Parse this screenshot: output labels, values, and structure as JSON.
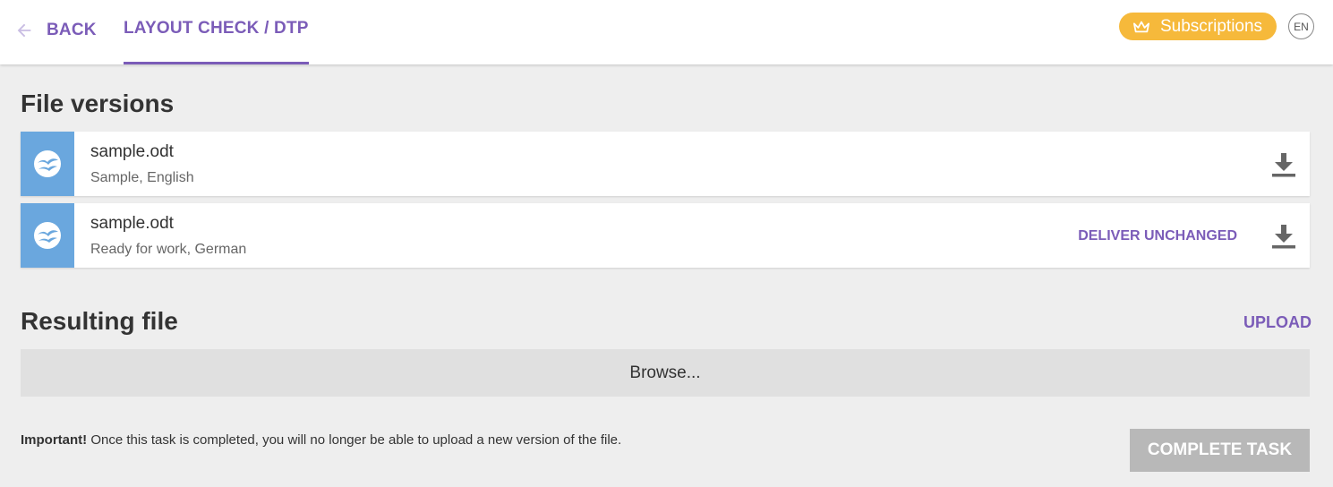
{
  "header": {
    "back_label": "BACK",
    "tab_label": "LAYOUT CHECK / DTP",
    "subscriptions_label": "Subscriptions",
    "language": "EN",
    "accent_color": "#7b5cb8",
    "subscriptions_color": "#f6b93b"
  },
  "file_versions": {
    "title": "File versions",
    "items": [
      {
        "name": "sample.odt",
        "meta": "Sample, English",
        "icon": "openoffice-icon",
        "action": ""
      },
      {
        "name": "sample.odt",
        "meta": "Ready for work, German",
        "icon": "openoffice-icon",
        "action": "DELIVER UNCHANGED"
      }
    ]
  },
  "resulting_file": {
    "title": "Resulting file",
    "upload_label": "UPLOAD",
    "browse_label": "Browse..."
  },
  "footer": {
    "important_label": "Important!",
    "notice_text": " Once this task is completed, you will no longer be able to upload a new version of the file.",
    "complete_label": "COMPLETE TASK"
  }
}
